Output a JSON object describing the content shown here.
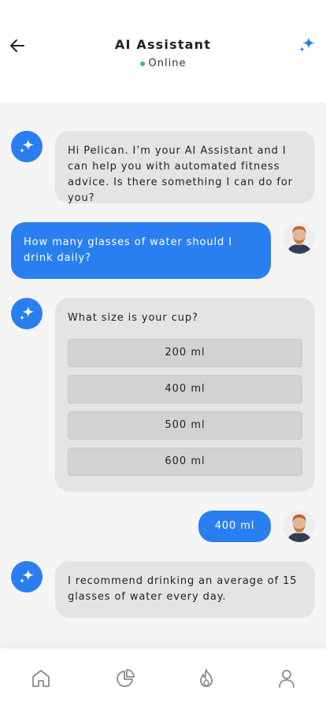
{
  "header": {
    "title": "AI Assistant",
    "status": "Online",
    "status_color": "#3fbf6b",
    "back_icon": "arrow-left-icon",
    "action_icon": "sparkle-icon"
  },
  "theme": {
    "accent": "#2a7ff0",
    "ai_bubble": "#e4e4e4",
    "background": "#f5f5f5"
  },
  "messages": [
    {
      "from": "ai",
      "text": "Hi Pelican. I’m your AI Assistant and I can help you with automated fitness advice. Is there something I can do for you?"
    },
    {
      "from": "user",
      "text": "How many glasses of water should I drink daily?"
    },
    {
      "from": "ai",
      "text": "What size is your cup?",
      "options": [
        "200 ml",
        "400 ml",
        "500 ml",
        "600 ml"
      ]
    },
    {
      "from": "user",
      "text": "400 ml"
    },
    {
      "from": "ai",
      "text": "I recommend drinking an average of 15 glasses of water every day."
    }
  ],
  "nav": [
    {
      "icon": "home-icon"
    },
    {
      "icon": "pie-chart-icon"
    },
    {
      "icon": "flame-icon"
    },
    {
      "icon": "profile-icon"
    }
  ]
}
